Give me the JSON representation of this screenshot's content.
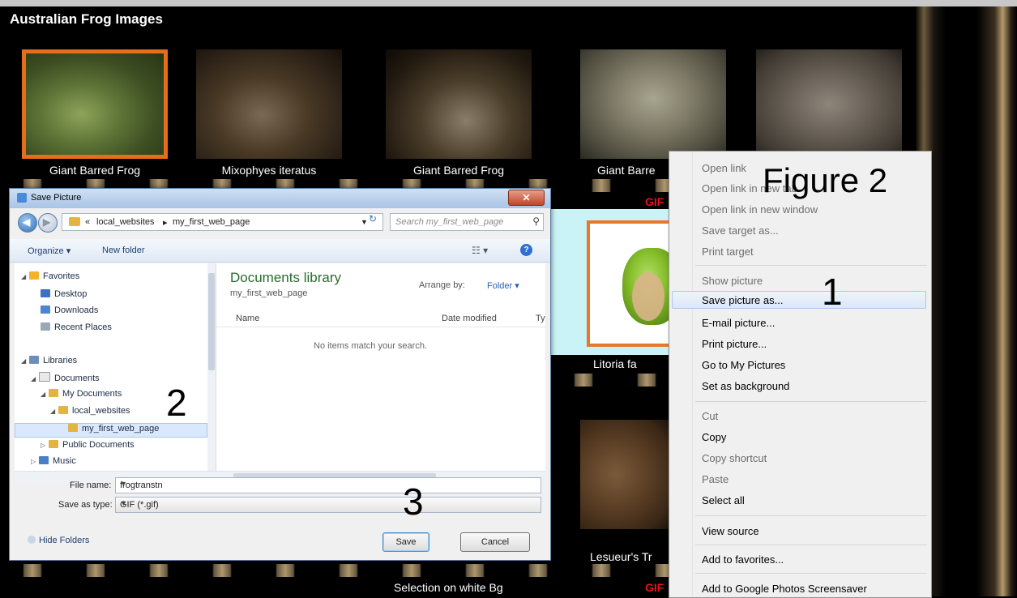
{
  "page": {
    "title": "Australian Frog Images",
    "captions": [
      "Giant Barred Frog",
      "Mixophyes iteratus",
      "Giant Barred Frog",
      "Giant Barre",
      "Litoria fa",
      "Lesueur's Tr",
      "Selection on white Bg"
    ],
    "gif_labels": [
      "GIF",
      "GIF"
    ]
  },
  "dialog": {
    "title": "Save Picture",
    "close_label": "✕",
    "breadcrumb": [
      "«",
      "local_websites",
      "▸",
      "my_first_web_page"
    ],
    "search_placeholder": "Search my_first_web_page",
    "toolbar": {
      "organize": "Organize ▾",
      "new_folder": "New folder"
    },
    "nav": {
      "favorites": "Favorites",
      "desktop": "Desktop",
      "downloads": "Downloads",
      "recent": "Recent Places",
      "libraries": "Libraries",
      "documents": "Documents",
      "my_documents": "My Documents",
      "local_websites": "local_websites",
      "my_first_web_page": "my_first_web_page",
      "public_documents": "Public Documents",
      "music": "Music"
    },
    "library": {
      "title": "Documents library",
      "subtitle": "my_first_web_page",
      "arrange_by_label": "Arrange by:",
      "arrange_by_value": "Folder ▾"
    },
    "columns": [
      "Name",
      "Date modified",
      "Ty"
    ],
    "empty_message": "No items match your search.",
    "file_name_label": "File name:",
    "file_name_value": "frogtranstn",
    "save_type_label": "Save as type:",
    "save_type_value": "GIF (*.gif)",
    "hide_folders": "Hide Folders",
    "save_button": "Save",
    "cancel_button": "Cancel"
  },
  "context_menu": {
    "items": [
      {
        "label": "Open link",
        "enabled": false
      },
      {
        "label": "Open link in new tab",
        "enabled": false
      },
      {
        "label": "Open link in new window",
        "enabled": false
      },
      {
        "label": "Save target as...",
        "enabled": false
      },
      {
        "label": "Print target",
        "enabled": false
      },
      {
        "label": "Show picture",
        "enabled": false
      },
      {
        "label": "Save picture as...",
        "enabled": true
      },
      {
        "label": "E-mail picture...",
        "enabled": true
      },
      {
        "label": "Print picture...",
        "enabled": true
      },
      {
        "label": "Go to My Pictures",
        "enabled": true
      },
      {
        "label": "Set as background",
        "enabled": true
      },
      {
        "label": "Cut",
        "enabled": false
      },
      {
        "label": "Copy",
        "enabled": true
      },
      {
        "label": "Copy shortcut",
        "enabled": false
      },
      {
        "label": "Paste",
        "enabled": false
      },
      {
        "label": "Select all",
        "enabled": true
      },
      {
        "label": "View source",
        "enabled": true
      },
      {
        "label": "Add to favorites...",
        "enabled": true
      },
      {
        "label": "Add to Google Photos Screensaver",
        "enabled": true
      }
    ]
  },
  "annotations": {
    "figure": "Figure 2",
    "step1": "1",
    "step2": "2",
    "step3": "3"
  }
}
